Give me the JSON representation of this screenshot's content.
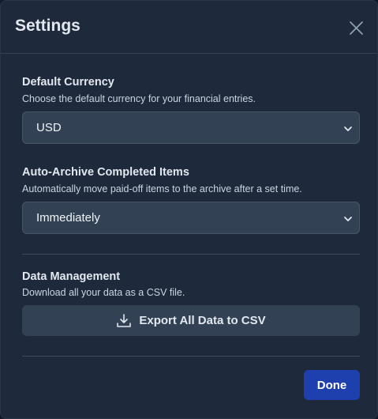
{
  "dialog": {
    "title": "Settings"
  },
  "currency": {
    "label": "Default Currency",
    "help": "Choose the default currency for your financial entries.",
    "selected": "USD"
  },
  "archive": {
    "label": "Auto-Archive Completed Items",
    "help": "Automatically move paid-off items to the archive after a set time.",
    "selected": "Immediately"
  },
  "data_management": {
    "label": "Data Management",
    "help": "Download all your data as a CSV file.",
    "export_label": "Export All Data to CSV"
  },
  "footer": {
    "done_label": "Done"
  },
  "icons": {
    "close": "close-icon",
    "chevron": "chevron-down-icon",
    "download": "download-icon"
  },
  "colors": {
    "background": "#1e293b",
    "field": "#334155",
    "primary_button": "#1e40af"
  }
}
